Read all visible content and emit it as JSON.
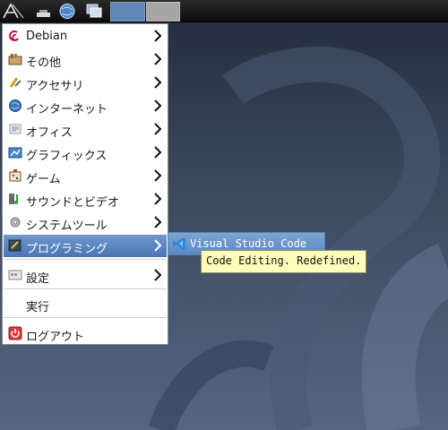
{
  "panel": {
    "icons": [
      "lxde-menu-icon",
      "desktop-icon",
      "browser-globe-icon",
      "windows-icon"
    ],
    "taskbar": [
      "active-task",
      "inactive-task"
    ]
  },
  "menu": {
    "items": [
      {
        "label": "Debian",
        "icon": "debian-swirl-icon",
        "has_submenu": true
      },
      {
        "label": "その他",
        "icon": "misc-apps-icon",
        "has_submenu": true
      },
      {
        "label": "アクセサリ",
        "icon": "accessories-icon",
        "has_submenu": true
      },
      {
        "label": "インターネット",
        "icon": "internet-globe-icon",
        "has_submenu": true
      },
      {
        "label": "オフィス",
        "icon": "office-icon",
        "has_submenu": true
      },
      {
        "label": "グラフィックス",
        "icon": "graphics-icon",
        "has_submenu": true
      },
      {
        "label": "ゲーム",
        "icon": "games-icon",
        "has_submenu": true
      },
      {
        "label": "サウンドとビデオ",
        "icon": "sound-video-icon",
        "has_submenu": true
      },
      {
        "label": "システムツール",
        "icon": "system-tools-icon",
        "has_submenu": true
      },
      {
        "label": "プログラミング",
        "icon": "programming-icon",
        "has_submenu": true,
        "selected": true
      },
      {
        "label": "設定",
        "icon": "settings-icon",
        "has_submenu": true
      },
      {
        "label": "実行",
        "icon": "",
        "has_submenu": false
      },
      {
        "label": "ログアウト",
        "icon": "logout-icon",
        "has_submenu": false
      }
    ]
  },
  "submenu": {
    "items": [
      {
        "label": "Visual Studio Code",
        "icon": "vscode-icon"
      }
    ]
  },
  "tooltip": {
    "text": "Code Editing. Redefined."
  },
  "colors": {
    "selection": "#5b85c0",
    "tooltip_bg": "#fefdb9",
    "panel_bg": "#1a1a1a",
    "desktop_bg": "#3a475c"
  }
}
